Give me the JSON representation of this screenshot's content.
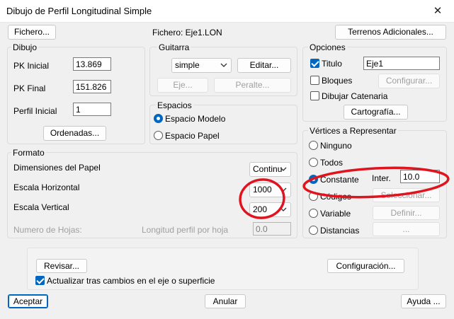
{
  "window": {
    "title": "Dibujo de Perfil Longitudinal Simple",
    "close_glyph": "✕"
  },
  "top": {
    "fichero_button": "Fichero...",
    "fichero_label": "Fichero: Eje1.LON",
    "terrenos_button": "Terrenos Adicionales..."
  },
  "dibujo": {
    "label": "Dibujo",
    "pk_inicial_label": "PK Inicial",
    "pk_inicial_value": "13.869",
    "pk_final_label": "PK Final",
    "pk_final_value": "151.826",
    "perfil_inicial_label": "Perfil Inicial",
    "perfil_inicial_value": "1",
    "ordenadas_button": "Ordenadas..."
  },
  "guitarra": {
    "label": "Guitarra",
    "select_value": "simple",
    "editar_button": "Editar...",
    "eje_button": "Eje...",
    "peralte_button": "Peralte..."
  },
  "espacios": {
    "label": "Espacios",
    "modelo": "Espacio Modelo",
    "papel": "Espacio Papel",
    "selected": "modelo"
  },
  "opciones": {
    "label": "Opciones",
    "titulo_label": "Titulo",
    "titulo_value": "Eje1",
    "titulo_checked": true,
    "bloques_label": "Bloques",
    "bloques_checked": false,
    "configurar_button": "Configurar...",
    "catenaria_label": "Dibujar Catenaria",
    "catenaria_checked": false,
    "cartografia_button": "Cartografía..."
  },
  "vertices": {
    "label": "Vértices a Representar",
    "ninguno": "Ninguno",
    "todos": "Todos",
    "constante": "Constante",
    "codigos": "Códigos",
    "variable": "Variable",
    "distancias": "Distancias",
    "selected": "constante",
    "inter_label": "Inter.",
    "inter_value": "10.0",
    "seleccionar_button": "Seleccionar...",
    "definir_button": "Definir...",
    "dots_button": "..."
  },
  "formato": {
    "label": "Formato",
    "dimensiones_label": "Dimensiones del Papel",
    "dimensiones_value": "Continu",
    "escala_h_label": "Escala Horizontal",
    "escala_h_value": "1000",
    "escala_v_label": "Escala Vertical",
    "escala_v_value": "200",
    "num_hojas_label": "Numero de Hojas:",
    "longitud_label": "Longitud perfil por hoja",
    "longitud_value": "0.0"
  },
  "bottom": {
    "revisar_button": "Revisar...",
    "configuracion_button": "Configuración...",
    "actualizar_label": "Actualizar tras cambios en el eje o superficie",
    "actualizar_checked": true,
    "aceptar_button": "Aceptar",
    "anular_button": "Anular",
    "ayuda_button": "Ayuda ..."
  },
  "colors": {
    "accent": "#0067c0",
    "annotation": "#e0141e"
  },
  "icons": {
    "caret": "chevron-down-icon",
    "close": "close-icon"
  }
}
